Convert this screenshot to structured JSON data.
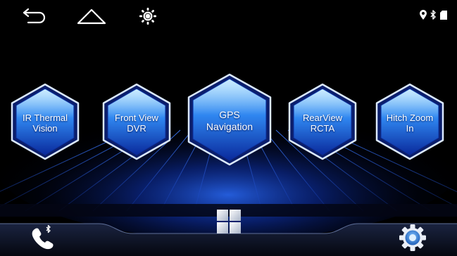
{
  "top_bar": {
    "icons": [
      "back-arrow-icon",
      "home-icon",
      "brightness-icon"
    ],
    "status_icons": [
      "location-pin-icon",
      "bluetooth-icon",
      "signal-icon"
    ]
  },
  "apps": [
    {
      "line1": "IR Thermal",
      "line2": "Vision"
    },
    {
      "line1": "Front View",
      "line2": "DVR"
    },
    {
      "line1": "GPS",
      "line2": "Navigation"
    },
    {
      "line1": "RearView",
      "line2": "RCTA"
    },
    {
      "line1": "Hitch Zoom",
      "line2": "In"
    }
  ],
  "dock": {
    "icons": [
      "phone-bluetooth-icon",
      "app-grid-icon",
      "settings-gear-icon"
    ]
  },
  "colors": {
    "background": "#000000",
    "hex_light": "#8fd6ff",
    "hex_dark": "#0a2a9c",
    "grid_glow": "#1e5cff",
    "icon_white": "#ffffff",
    "settings_blue": "#2f7bd6"
  }
}
